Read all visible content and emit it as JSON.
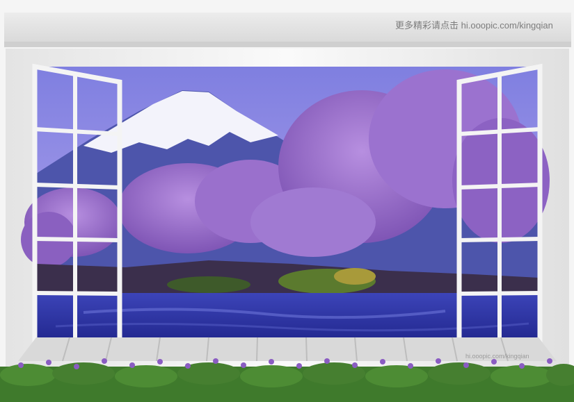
{
  "watermark_top": "更多精彩请点击 hi.ooopic.com/kingqian",
  "watermark_bottom": "hi.ooopic.com/kingqian",
  "scene": {
    "description_icons": [
      "mount-fuji",
      "cherry-blossom-trees",
      "river",
      "open-window",
      "wooden-deck",
      "lavender-planter"
    ],
    "colors": {
      "sky": "#8f8fe6",
      "snow": "#f4f4fb",
      "mountain": "#4c52a8",
      "blossom": "#9a6fc9",
      "river": "#2f37a8",
      "frame": "#f2f2f2",
      "deck": "#d7d7d7",
      "foliage": "#3f7a2c",
      "flower": "#8a5cc2"
    }
  }
}
